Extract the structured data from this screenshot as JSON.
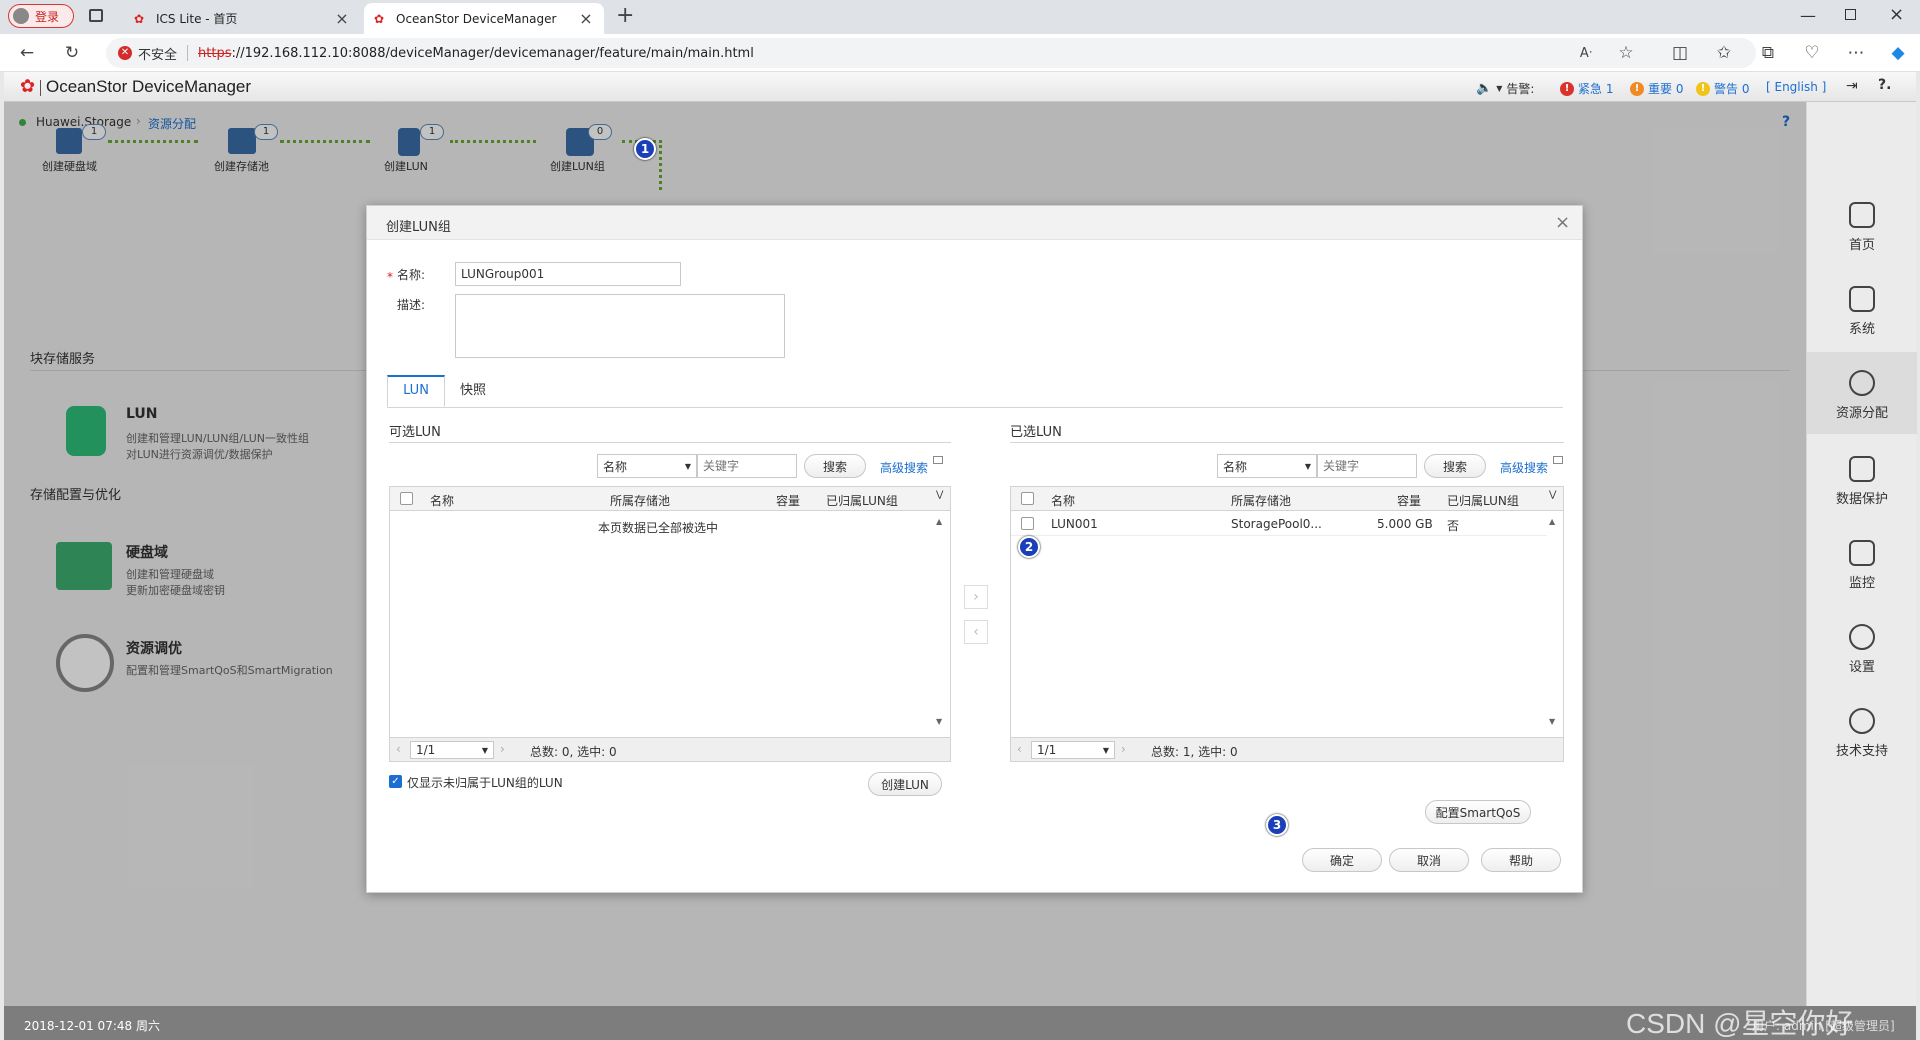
{
  "browser": {
    "profile_label": "登录",
    "tabs": [
      {
        "title": "ICS Lite - 首页"
      },
      {
        "title": "OceanStor DeviceManager"
      }
    ],
    "security_label": "不安全",
    "url_scheme": "https",
    "url_rest": "://192.168.112.10:8088/deviceManager/devicemanager/feature/main/main.html"
  },
  "app": {
    "title": "OceanStor DeviceManager",
    "alarm_label": "告警:",
    "alarms": [
      {
        "label": "紧急 1",
        "color": "#d9342b"
      },
      {
        "label": "重要 0",
        "color": "#f08a24"
      },
      {
        "label": "警告 0",
        "color": "#f0c419"
      }
    ],
    "language": "[ English ]",
    "breadcrumb": {
      "root": "Huawei.Storage",
      "current": "资源分配"
    },
    "help_q": "?"
  },
  "wizard": [
    {
      "label": "创建硬盘域",
      "count": "1"
    },
    {
      "label": "创建存储池",
      "count": "1"
    },
    {
      "label": "创建LUN",
      "count": "1"
    },
    {
      "label": "创建LUN组",
      "count": "0"
    }
  ],
  "sections": {
    "block": "块存储服务",
    "config": "存储配置与优化"
  },
  "cards": [
    {
      "title": "LUN",
      "line1": "创建和管理LUN/LUN组/LUN一致性组",
      "line2": "对LUN进行资源调优/数据保护"
    },
    {
      "title": "硬盘域",
      "line1": "创建和管理硬盘域",
      "line2": "更新加密硬盘域密钥"
    },
    {
      "title": "资源调优",
      "line1": "配置和管理SmartQoS和SmartMigration",
      "line2": ""
    }
  ],
  "sidebar": [
    {
      "label": "首页"
    },
    {
      "label": "系统"
    },
    {
      "label": "资源分配"
    },
    {
      "label": "数据保护"
    },
    {
      "label": "监控"
    },
    {
      "label": "设置"
    },
    {
      "label": "技术支持"
    }
  ],
  "footer": {
    "datetime": "2018-12-01 07:48 周六",
    "user": "用户: admin [超级管理员]",
    "watermark": "CSDN @星空你好"
  },
  "modal": {
    "title": "创建LUN组",
    "name_label": "名称:",
    "name_value": "LUNGroup001",
    "desc_label": "描述:",
    "tabs": [
      "LUN",
      "快照"
    ],
    "left": {
      "title": "可选LUN",
      "filter_field": "名称",
      "keyword_placeholder": "关键字",
      "search": "搜索",
      "advanced": "高级搜索",
      "columns": [
        "名称",
        "所属存储池",
        "容量",
        "已归属LUN组"
      ],
      "empty_text": "本页数据已全部被选中",
      "page": "1/1",
      "summary": "总数: 0, 选中: 0",
      "checkbox_label": "仅显示未归属于LUN组的LUN",
      "create_button": "创建LUN"
    },
    "right": {
      "title": "已选LUN",
      "filter_field": "名称",
      "keyword_placeholder": "关键字",
      "search": "搜索",
      "advanced": "高级搜索",
      "columns": [
        "名称",
        "所属存储池",
        "容量",
        "已归属LUN组"
      ],
      "rows": [
        {
          "name": "LUN001",
          "pool": "StoragePool0...",
          "capacity": "5.000 GB",
          "in_group": "否"
        }
      ],
      "page": "1/1",
      "summary": "总数: 1, 选中: 0",
      "smartqos_button": "配置SmartQoS"
    },
    "ok": "确定",
    "cancel": "取消",
    "help": "帮助"
  },
  "badges": [
    "1",
    "2",
    "3"
  ]
}
